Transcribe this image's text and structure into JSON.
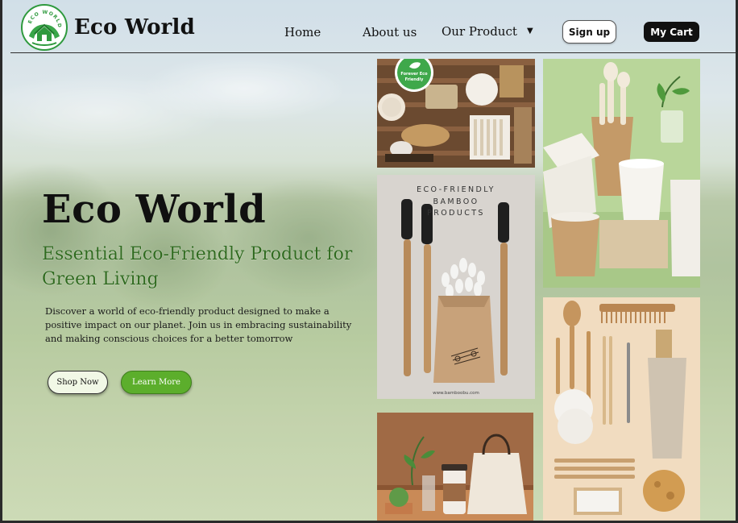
{
  "header": {
    "brand_name": "Eco World",
    "logo_text": "ECO WORLD",
    "nav": {
      "home": "Home",
      "about": "About us",
      "product": "Our Product"
    },
    "signup_label": "Sign up",
    "cart_label": "My Cart"
  },
  "hero": {
    "title": "Eco World",
    "subtitle": "Essential Eco-Friendly Product for Green Living",
    "description": "Discover a world of eco-friendly product designed to make  a positive impact  on our planet. Join us in embracing sustainability and making conscious choices for a better tomorrow",
    "shop_label": "Shop Now",
    "learn_label": "Learn More"
  },
  "gallery": {
    "badge_line1": "Forever Eco",
    "badge_line2": "Friendly",
    "bamboo_line1": "ECO-FRIENDLY",
    "bamboo_line2": "BAMBOO",
    "bamboo_line3": "PRODUCTS",
    "bamboo_url": "www.bamboobu.com"
  },
  "icons": {
    "logo": "eco-house-leaf-icon",
    "caret": "caret-down-icon",
    "badge": "leaf-badge-icon"
  },
  "colors": {
    "accent_green": "#5cae2c",
    "subtitle_green": "#2f6a1e",
    "logo_green": "#2f9a3e",
    "cart_bg": "#111111"
  }
}
